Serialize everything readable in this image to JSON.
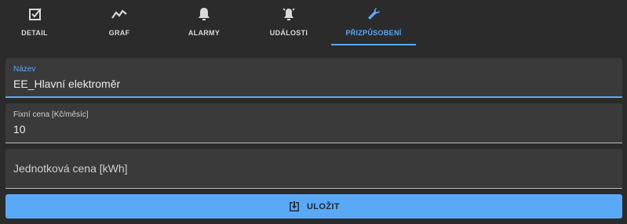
{
  "tabs": [
    {
      "label": "DETAIL",
      "icon": "checkbox-edit-icon"
    },
    {
      "label": "GRAF",
      "icon": "chart-line-icon"
    },
    {
      "label": "ALARMY",
      "icon": "bell-icon"
    },
    {
      "label": "UDÁLOSTI",
      "icon": "alarm-bell-icon"
    },
    {
      "label": "PŘIZPŮSOBENÍ",
      "icon": "wrench-icon"
    }
  ],
  "form": {
    "name": {
      "label": "Název",
      "value": "EE_Hlavní elektroměr"
    },
    "fixed_price": {
      "label": "Fixní cena [Kč/měsíc]",
      "value": "10"
    },
    "unit_price": {
      "placeholder": "Jednotková cena [kWh]"
    }
  },
  "save_button": {
    "label": "ULOŽIT",
    "icon": "save-icon"
  },
  "colors": {
    "accent": "#5aa9f7",
    "background": "#2b2b2b",
    "field_bg": "#3a3a3a"
  }
}
